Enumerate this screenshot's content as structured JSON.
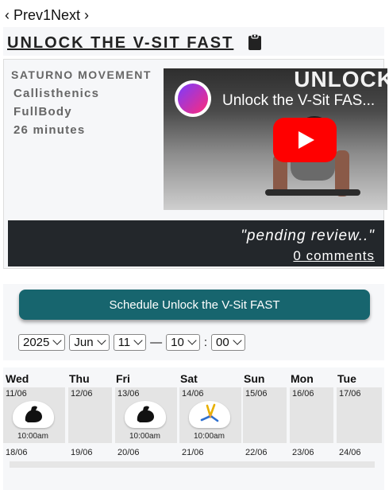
{
  "pager": {
    "prev": "‹ Prev",
    "page": "1",
    "next": "Next ›"
  },
  "header": {
    "title": "UNLOCK THE V-SIT FAST",
    "icon": "clipboard-icon"
  },
  "info": {
    "org": "SATURNO MOVEMENT",
    "category": "Callisthenics",
    "focus": "FullBody",
    "duration": "26 minutes"
  },
  "video": {
    "title": "Unlock the V-Sit FAS...",
    "background_word": "UNLOCK",
    "icon": "play-icon",
    "brand_color": "#ff0000"
  },
  "review": {
    "status": "\"pending review..\"",
    "comments_link": "0 comments"
  },
  "schedule": {
    "button_label": "Schedule Unlock the V-Sit FAST",
    "year": "2025",
    "month": "Jun",
    "day": "11",
    "separator": "—",
    "hour": "10",
    "colon": ":",
    "minute": "00",
    "accent_color": "#17656e"
  },
  "calendar": {
    "days": [
      {
        "name": "Wed",
        "date": "11/06",
        "next_date": "18/06",
        "workout": {
          "icon": "flexed-bicep-icon",
          "time": "10:00am"
        }
      },
      {
        "name": "Thu",
        "date": "12/06",
        "next_date": "19/06"
      },
      {
        "name": "Fri",
        "date": "13/06",
        "next_date": "20/06",
        "workout": {
          "icon": "flexed-bicep-icon",
          "time": "10:00am"
        }
      },
      {
        "name": "Sat",
        "date": "14/06",
        "next_date": "21/06",
        "workout": {
          "icon": "cartwheel-icon",
          "time": "10:00am"
        }
      },
      {
        "name": "Sun",
        "date": "15/06",
        "next_date": "22/06"
      },
      {
        "name": "Mon",
        "date": "16/06",
        "next_date": "23/06"
      },
      {
        "name": "Tue",
        "date": "17/06",
        "next_date": "24/06"
      }
    ]
  }
}
